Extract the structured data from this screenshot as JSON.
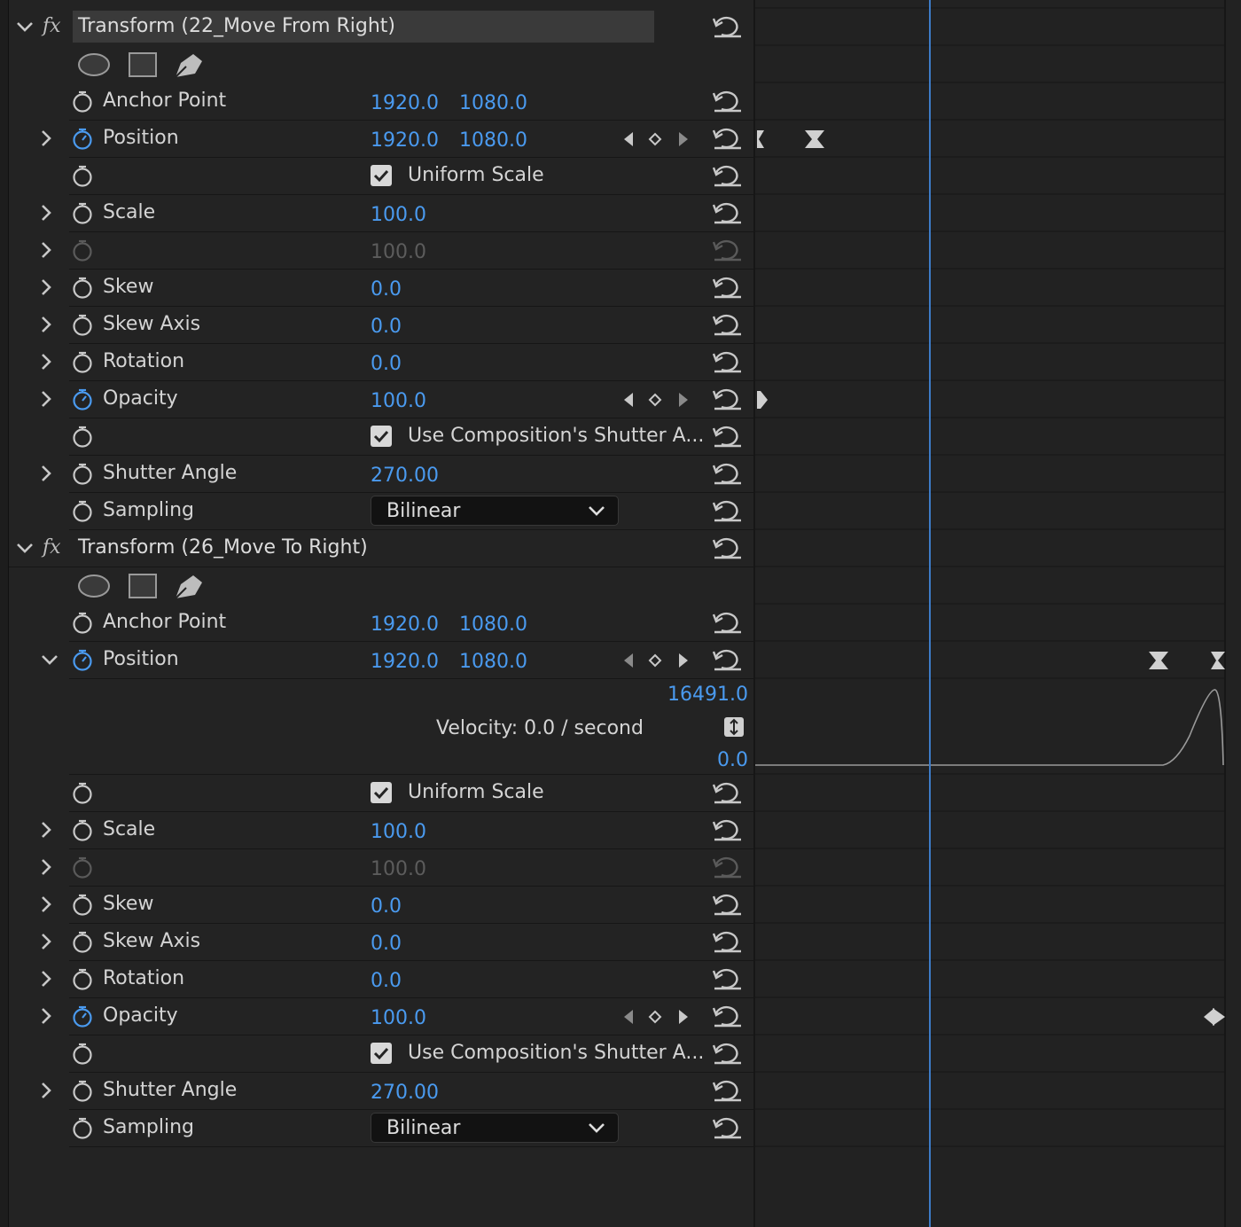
{
  "colors": {
    "background": "#232323",
    "value_blue": "#4a9aef",
    "playhead": "#3d7bc7",
    "text": "#d4d4d4"
  },
  "effect1": {
    "fx_label": "fx",
    "title": "Transform (22_Move From Right)",
    "anchor_point": {
      "label": "Anchor Point",
      "x": "1920.0",
      "y": "1080.0"
    },
    "position": {
      "label": "Position",
      "x": "1920.0",
      "y": "1080.0"
    },
    "uniform_scale": {
      "label": "Uniform Scale",
      "checked": true
    },
    "scale": {
      "label": "Scale",
      "value": "100.0"
    },
    "scale_width": {
      "value": "100.0"
    },
    "skew": {
      "label": "Skew",
      "value": "0.0"
    },
    "skew_axis": {
      "label": "Skew Axis",
      "value": "0.0"
    },
    "rotation": {
      "label": "Rotation",
      "value": "0.0"
    },
    "opacity": {
      "label": "Opacity",
      "value": "100.0"
    },
    "use_comp_shutter": {
      "label": "Use Composition's Shutter A...",
      "checked": true
    },
    "shutter_angle": {
      "label": "Shutter Angle",
      "value": "270.00"
    },
    "sampling": {
      "label": "Sampling",
      "value": "Bilinear"
    }
  },
  "effect2": {
    "fx_label": "fx",
    "title": "Transform (26_Move To Right)",
    "anchor_point": {
      "label": "Anchor Point",
      "x": "1920.0",
      "y": "1080.0"
    },
    "position": {
      "label": "Position",
      "x": "1920.0",
      "y": "1080.0"
    },
    "velocity_graph": {
      "max": "16491.0",
      "min": "0.0",
      "velocity_label": "Velocity: 0.0 / second"
    },
    "uniform_scale": {
      "label": "Uniform Scale",
      "checked": true
    },
    "scale": {
      "label": "Scale",
      "value": "100.0"
    },
    "scale_width": {
      "value": "100.0"
    },
    "skew": {
      "label": "Skew",
      "value": "0.0"
    },
    "skew_axis": {
      "label": "Skew Axis",
      "value": "0.0"
    },
    "rotation": {
      "label": "Rotation",
      "value": "0.0"
    },
    "opacity": {
      "label": "Opacity",
      "value": "100.0"
    },
    "use_comp_shutter": {
      "label": "Use Composition's Shutter A...",
      "checked": true
    },
    "shutter_angle": {
      "label": "Shutter Angle",
      "value": "270.00"
    },
    "sampling": {
      "label": "Sampling",
      "value": "Bilinear"
    }
  }
}
